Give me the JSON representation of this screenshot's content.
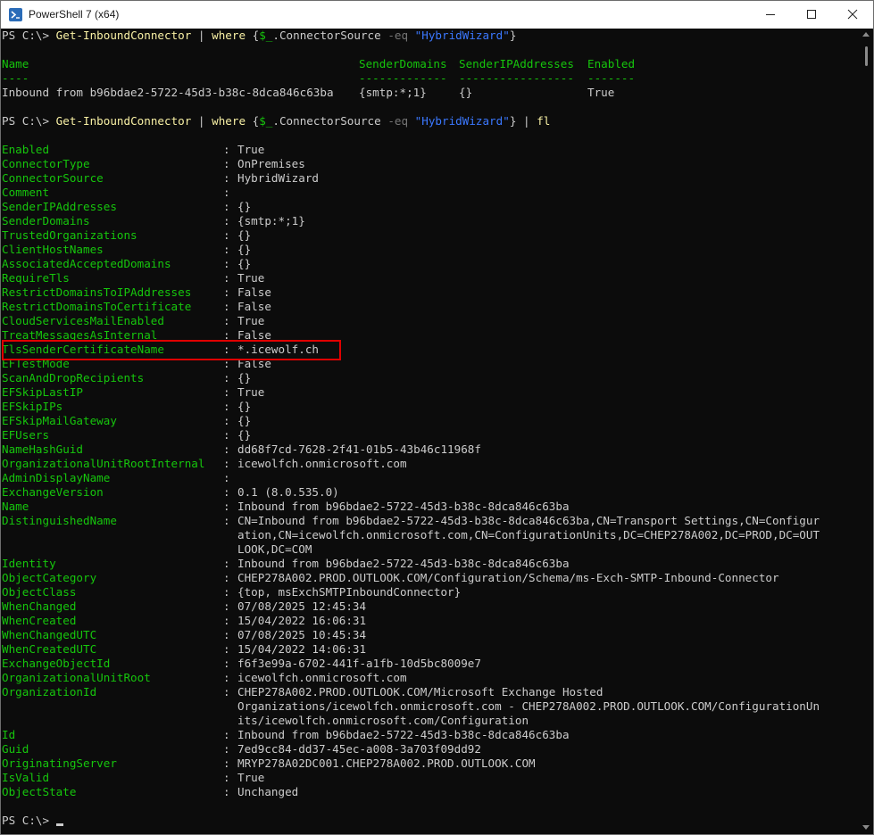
{
  "window": {
    "title": "PowerShell 7 (x64)"
  },
  "commands": {
    "prompt": "PS C:\\>",
    "cmdlet": "Get-InboundConnector",
    "pipe": "|",
    "where": "where",
    "brace_open": "{",
    "variable": "$_",
    "property": ".ConnectorSource",
    "operator": "-eq",
    "string": "\"HybridWizard\"",
    "brace_close": "}",
    "fl": "fl"
  },
  "table": {
    "headers": [
      "Name",
      "SenderDomains",
      "SenderIPAddresses",
      "Enabled"
    ],
    "dashes": [
      "----",
      "-------------",
      "-----------------",
      "-------"
    ],
    "row": [
      "Inbound from b96bdae2-5722-45d3-b38c-8dca846c63ba",
      "{smtp:*;1}",
      "{}",
      "True"
    ]
  },
  "properties": [
    {
      "label": "Enabled",
      "lines": [
        "True"
      ]
    },
    {
      "label": "ConnectorType",
      "lines": [
        "OnPremises"
      ]
    },
    {
      "label": "ConnectorSource",
      "lines": [
        "HybridWizard"
      ]
    },
    {
      "label": "Comment",
      "lines": [
        ""
      ]
    },
    {
      "label": "SenderIPAddresses",
      "lines": [
        "{}"
      ]
    },
    {
      "label": "SenderDomains",
      "lines": [
        "{smtp:*;1}"
      ]
    },
    {
      "label": "TrustedOrganizations",
      "lines": [
        "{}"
      ]
    },
    {
      "label": "ClientHostNames",
      "lines": [
        "{}"
      ]
    },
    {
      "label": "AssociatedAcceptedDomains",
      "lines": [
        "{}"
      ]
    },
    {
      "label": "RequireTls",
      "lines": [
        "True"
      ]
    },
    {
      "label": "RestrictDomainsToIPAddresses",
      "lines": [
        "False"
      ]
    },
    {
      "label": "RestrictDomainsToCertificate",
      "lines": [
        "False"
      ]
    },
    {
      "label": "CloudServicesMailEnabled",
      "lines": [
        "True"
      ]
    },
    {
      "label": "TreatMessagesAsInternal",
      "lines": [
        "False"
      ]
    },
    {
      "label": "TlsSenderCertificateName",
      "lines": [
        "*.icewolf.ch"
      ]
    },
    {
      "label": "EFTestMode",
      "lines": [
        "False"
      ]
    },
    {
      "label": "ScanAndDropRecipients",
      "lines": [
        "{}"
      ]
    },
    {
      "label": "EFSkipLastIP",
      "lines": [
        "True"
      ]
    },
    {
      "label": "EFSkipIPs",
      "lines": [
        "{}"
      ]
    },
    {
      "label": "EFSkipMailGateway",
      "lines": [
        "{}"
      ]
    },
    {
      "label": "EFUsers",
      "lines": [
        "{}"
      ]
    },
    {
      "label": "NameHashGuid",
      "lines": [
        "dd68f7cd-7628-2f41-01b5-43b46c11968f"
      ]
    },
    {
      "label": "OrganizationalUnitRootInternal",
      "lines": [
        "icewolfch.onmicrosoft.com"
      ]
    },
    {
      "label": "AdminDisplayName",
      "lines": [
        ""
      ]
    },
    {
      "label": "ExchangeVersion",
      "lines": [
        "0.1 (8.0.535.0)"
      ]
    },
    {
      "label": "Name",
      "lines": [
        "Inbound from b96bdae2-5722-45d3-b38c-8dca846c63ba"
      ]
    },
    {
      "label": "DistinguishedName",
      "lines": [
        "CN=Inbound from b96bdae2-5722-45d3-b38c-8dca846c63ba,CN=Transport Settings,CN=Configur",
        "ation,CN=icewolfch.onmicrosoft.com,CN=ConfigurationUnits,DC=CHEP278A002,DC=PROD,DC=OUT",
        "LOOK,DC=COM"
      ]
    },
    {
      "label": "Identity",
      "lines": [
        "Inbound from b96bdae2-5722-45d3-b38c-8dca846c63ba"
      ]
    },
    {
      "label": "ObjectCategory",
      "lines": [
        "CHEP278A002.PROD.OUTLOOK.COM/Configuration/Schema/ms-Exch-SMTP-Inbound-Connector"
      ]
    },
    {
      "label": "ObjectClass",
      "lines": [
        "{top, msExchSMTPInboundConnector}"
      ]
    },
    {
      "label": "WhenChanged",
      "lines": [
        "07/08/2025 12:45:34"
      ]
    },
    {
      "label": "WhenCreated",
      "lines": [
        "15/04/2022 16:06:31"
      ]
    },
    {
      "label": "WhenChangedUTC",
      "lines": [
        "07/08/2025 10:45:34"
      ]
    },
    {
      "label": "WhenCreatedUTC",
      "lines": [
        "15/04/2022 14:06:31"
      ]
    },
    {
      "label": "ExchangeObjectId",
      "lines": [
        "f6f3e99a-6702-441f-a1fb-10d5bc8009e7"
      ]
    },
    {
      "label": "OrganizationalUnitRoot",
      "lines": [
        "icewolfch.onmicrosoft.com"
      ]
    },
    {
      "label": "OrganizationId",
      "lines": [
        "CHEP278A002.PROD.OUTLOOK.COM/Microsoft Exchange Hosted",
        "Organizations/icewolfch.onmicrosoft.com - CHEP278A002.PROD.OUTLOOK.COM/ConfigurationUn",
        "its/icewolfch.onmicrosoft.com/Configuration"
      ]
    },
    {
      "label": "Id",
      "lines": [
        "Inbound from b96bdae2-5722-45d3-b38c-8dca846c63ba"
      ]
    },
    {
      "label": "Guid",
      "lines": [
        "7ed9cc84-dd37-45ec-a008-3a703f09dd92"
      ]
    },
    {
      "label": "OriginatingServer",
      "lines": [
        "MRYP278A02DC001.CHEP278A002.PROD.OUTLOOK.COM"
      ]
    },
    {
      "label": "IsValid",
      "lines": [
        "True"
      ]
    },
    {
      "label": "ObjectState",
      "lines": [
        "Unchanged"
      ]
    }
  ],
  "colors": {
    "background": "#0c0c0c",
    "text": "#cccccc",
    "property_label": "#16c60c",
    "cmdlet": "#f9f1a5",
    "string": "#3b78ff",
    "operator": "#767676",
    "highlight_box": "#e00000"
  },
  "icons": [
    "powershell-app-icon",
    "minimize-icon",
    "maximize-icon",
    "close-icon"
  ]
}
